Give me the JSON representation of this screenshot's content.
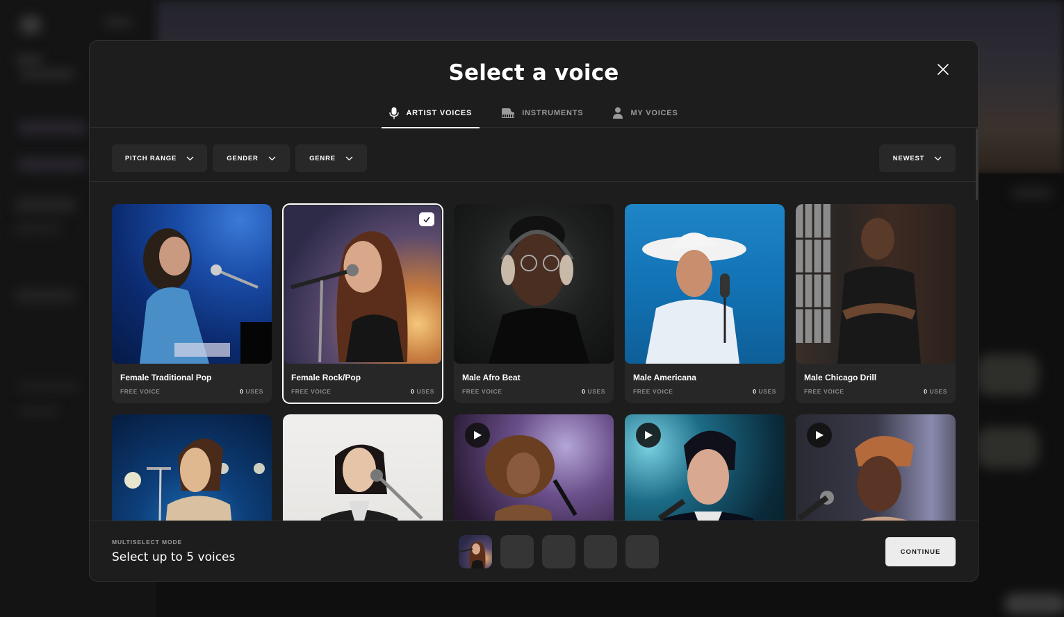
{
  "modal": {
    "title": "Select a voice",
    "close_icon": "close-icon"
  },
  "tabs": [
    {
      "label": "ARTIST VOICES",
      "icon": "microphone-icon",
      "active": true
    },
    {
      "label": "INSTRUMENTS",
      "icon": "piano-icon",
      "active": false
    },
    {
      "label": "MY VOICES",
      "icon": "user-icon",
      "active": false
    }
  ],
  "filters": {
    "pitch_range": "PITCH RANGE",
    "gender": "GENDER",
    "genre": "GENRE",
    "sort": "NEWEST"
  },
  "voices": [
    {
      "name": "Female Traditional Pop",
      "tier": "FREE VOICE",
      "uses_count": "0",
      "uses_label": "USES",
      "selected": false
    },
    {
      "name": "Female Rock/Pop",
      "tier": "FREE VOICE",
      "uses_count": "0",
      "uses_label": "USES",
      "selected": true
    },
    {
      "name": "Male Afro Beat",
      "tier": "FREE VOICE",
      "uses_count": "0",
      "uses_label": "USES",
      "selected": false
    },
    {
      "name": "Male Americana",
      "tier": "FREE VOICE",
      "uses_count": "0",
      "uses_label": "USES",
      "selected": false
    },
    {
      "name": "Male Chicago Drill",
      "tier": "FREE VOICE",
      "uses_count": "0",
      "uses_label": "USES",
      "selected": false
    },
    {
      "name": "",
      "selected": false,
      "play_button": false
    },
    {
      "name": "",
      "selected": false,
      "play_button": false
    },
    {
      "name": "",
      "selected": false,
      "play_button": true
    },
    {
      "name": "",
      "selected": false,
      "play_button": true
    },
    {
      "name": "",
      "selected": false,
      "play_button": true
    }
  ],
  "footer": {
    "mode_label": "MULTISELECT MODE",
    "instruction": "Select up to 5 voices",
    "slots_total": 5,
    "slots_filled": 1,
    "continue_label": "CONTINUE"
  }
}
